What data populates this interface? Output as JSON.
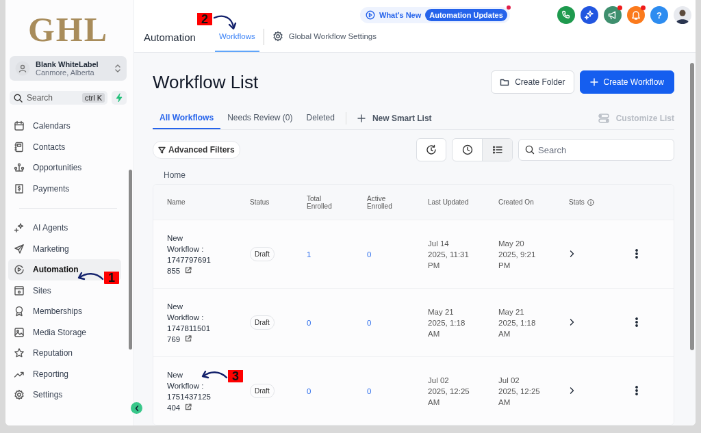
{
  "sidebar": {
    "logo": "GHL",
    "account": {
      "name": "Blank WhiteLabel",
      "location": "Canmore, Alberta"
    },
    "search": {
      "placeholder": "Search",
      "shortcut": "ctrl K"
    },
    "nav_groups": [
      [
        {
          "label": "Calendars",
          "selected": false
        },
        {
          "label": "Contacts",
          "selected": false
        },
        {
          "label": "Opportunities",
          "selected": false
        },
        {
          "label": "Payments",
          "selected": false
        }
      ],
      [
        {
          "label": "AI Agents",
          "selected": false
        },
        {
          "label": "Marketing",
          "selected": false
        },
        {
          "label": "Automation",
          "selected": true
        },
        {
          "label": "Sites",
          "selected": false
        },
        {
          "label": "Memberships",
          "selected": false
        },
        {
          "label": "Media Storage",
          "selected": false
        },
        {
          "label": "Reputation",
          "selected": false
        },
        {
          "label": "Reporting",
          "selected": false
        },
        {
          "label": "Settings",
          "selected": false
        }
      ]
    ]
  },
  "header": {
    "title": "Automation",
    "tabs": [
      {
        "label": "Workflows",
        "selected": true
      },
      {
        "label": "Global Workflow Settings",
        "selected": false
      }
    ],
    "whats_new": {
      "label": "What's New",
      "badge": "Automation Updates"
    },
    "icon_buttons": [
      {
        "kind": "phone",
        "color": "#1e9a4e",
        "alert": false
      },
      {
        "kind": "sparkle",
        "color": "#2256e0",
        "alert": false
      },
      {
        "kind": "megaphone",
        "color": "#3e8f6e",
        "alert": true
      },
      {
        "kind": "bell",
        "color": "#fb7a1c",
        "alert": true
      },
      {
        "kind": "help",
        "label": "?",
        "color": "#2d8cf0",
        "alert": false
      },
      {
        "kind": "avatar"
      }
    ]
  },
  "page": {
    "title": "Workflow List",
    "buttons": [
      {
        "kind": "secondary",
        "label": "Create Folder"
      },
      {
        "kind": "primary",
        "label": "Create Workflow"
      }
    ],
    "list_tabs": [
      {
        "label": "All Workflows",
        "selected": true
      },
      {
        "label": "Needs Review (0)",
        "selected": false
      },
      {
        "label": "Deleted",
        "selected": false
      }
    ],
    "new_smart_list": "New Smart List",
    "customize_list": {
      "label": "Customize List",
      "disabled": true
    },
    "advanced_filters": "Advanced Filters",
    "view_toggle": [
      {
        "kind": "clock",
        "selected": false
      },
      {
        "kind": "list",
        "selected": true
      }
    ],
    "search": {
      "placeholder": "Search"
    },
    "breadcrumb": "Home",
    "table": {
      "columns": [
        "Name",
        "Status",
        "Total Enrolled",
        "Active Enrolled",
        "Last Updated",
        "Created On",
        "Stats"
      ],
      "rows": [
        {
          "name": "New Workflow : 1747797691855",
          "status": "Draft",
          "total_enrolled": "1",
          "active_enrolled": "0",
          "last_updated": "Jul 14 2025, 11:31 PM",
          "created_on": "May 20 2025, 9:21 PM"
        },
        {
          "name": "New Workflow : 1747811501769",
          "status": "Draft",
          "total_enrolled": "0",
          "active_enrolled": "0",
          "last_updated": "May 21 2025, 1:18 AM",
          "created_on": "May 21 2025, 1:18 AM"
        },
        {
          "name": "New Workflow : 1751437125404",
          "status": "Draft",
          "total_enrolled": "0",
          "active_enrolled": "0",
          "last_updated": "Jul 02 2025, 12:25 AM",
          "created_on": "Jul 02 2025, 12:25 AM"
        }
      ]
    }
  },
  "annotations": [
    {
      "number": "1"
    },
    {
      "number": "2"
    },
    {
      "number": "3"
    }
  ]
}
